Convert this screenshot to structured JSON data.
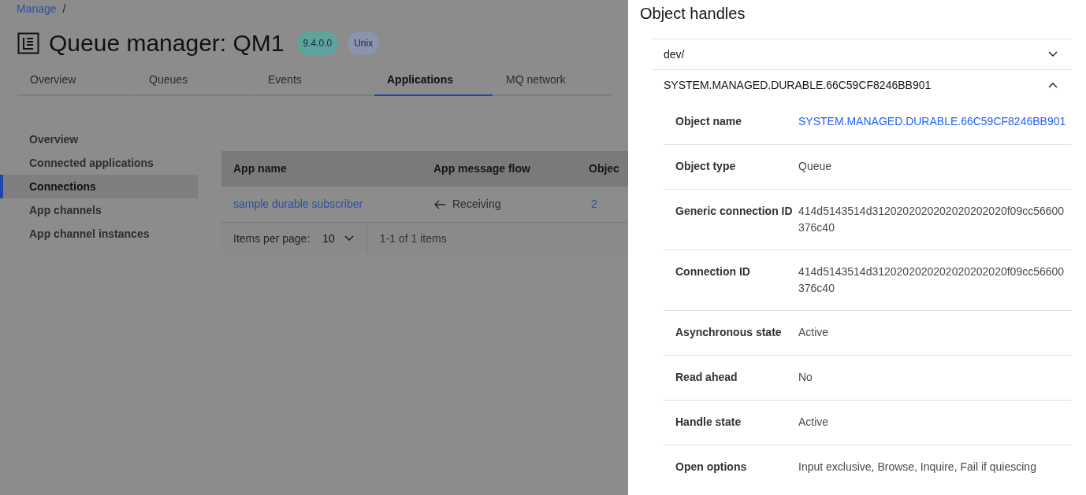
{
  "breadcrumb": {
    "link": "Manage",
    "separator": "/"
  },
  "header": {
    "title": "Queue manager: QM1",
    "badges": [
      {
        "text": "9.4.0.0",
        "color": "#5fa39d"
      },
      {
        "text": "Unix",
        "color": "#8a94ac"
      }
    ]
  },
  "tabs": [
    {
      "label": "Overview",
      "selected": false
    },
    {
      "label": "Queues",
      "selected": false
    },
    {
      "label": "Events",
      "selected": false
    },
    {
      "label": "Applications",
      "selected": true
    },
    {
      "label": "MQ network",
      "selected": false
    }
  ],
  "sidebar": {
    "items": [
      {
        "label": "Overview",
        "selected": false
      },
      {
        "label": "Connected applications",
        "selected": false
      },
      {
        "label": "Connections",
        "selected": true
      },
      {
        "label": "App channels",
        "selected": false
      },
      {
        "label": "App channel instances",
        "selected": false
      }
    ]
  },
  "table": {
    "columns": [
      "App name",
      "App message flow",
      "Objec"
    ],
    "rows": [
      {
        "app_name": "sample durable subscriber",
        "flow": "Receiving",
        "column_3": "2"
      }
    ],
    "pagination": {
      "label": "Items per page:",
      "value": "10",
      "range": "1-1 of 1 items"
    }
  },
  "panel": {
    "title": "Object handles",
    "sections": [
      {
        "title": "dev/",
        "expanded": false
      },
      {
        "title": "SYSTEM.MANAGED.DURABLE.66C59CF8246BB901",
        "expanded": true,
        "fields": [
          {
            "label": "Object name",
            "value": "SYSTEM.MANAGED.DURABLE.66C59CF8246BB901",
            "kind": "link"
          },
          {
            "label": "Object type",
            "value": "Queue",
            "kind": "text"
          },
          {
            "label": "Generic connection ID",
            "value": "414d5143514d3120202020202020202020f09cc56600376c40",
            "kind": "text"
          },
          {
            "label": "Connection ID",
            "value": "414d5143514d3120202020202020202020f09cc56600376c40",
            "kind": "text"
          },
          {
            "label": "Asynchronous state",
            "value": "Active",
            "kind": "text"
          },
          {
            "label": "Read ahead",
            "value": "No",
            "kind": "text"
          },
          {
            "label": "Handle state",
            "value": "Active",
            "kind": "text"
          },
          {
            "label": "Open options",
            "value": "Input exclusive, Browse, Inquire, Fail if quiescing",
            "kind": "text"
          }
        ]
      }
    ]
  }
}
